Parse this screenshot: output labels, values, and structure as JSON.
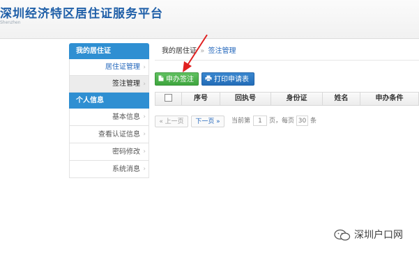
{
  "header": {
    "title": "深圳经济特区居住证服务平台",
    "subtitle": "Shenzhen"
  },
  "sidebar": {
    "group1_title": "我的居住证",
    "group1_items": [
      {
        "label": "居住证管理",
        "active": false
      },
      {
        "label": "签注管理",
        "active": true
      }
    ],
    "group2_title": "个人信息",
    "group2_items": [
      {
        "label": "基本信息"
      },
      {
        "label": "查看认证信息"
      },
      {
        "label": "密码修改"
      },
      {
        "label": "系统消息"
      }
    ],
    "chevron": "›"
  },
  "breadcrumb": {
    "item1": "我的居住证",
    "separator": "»",
    "item2": "签注管理"
  },
  "toolbar": {
    "apply_label": "申办签注",
    "print_label": "打印申请表",
    "apply_icon": "document-icon",
    "print_icon": "printer-icon"
  },
  "table": {
    "columns": [
      "序号",
      "回执号",
      "身份证",
      "姓名",
      "申办条件"
    ]
  },
  "pager": {
    "prev": "« 上一页",
    "next": "下一页 »",
    "current_prefix": "当前第",
    "current_page": "1",
    "page_suffix": "页，每页",
    "per_page": "30",
    "count_suffix": "条"
  },
  "watermark": {
    "text": "深圳户口网"
  },
  "colors": {
    "title_blue": "#1f5fa8",
    "sidebar_head": "#2f8fd2",
    "btn_green": "#3ea53e",
    "btn_blue": "#236db8",
    "arrow_red": "#e02020"
  }
}
